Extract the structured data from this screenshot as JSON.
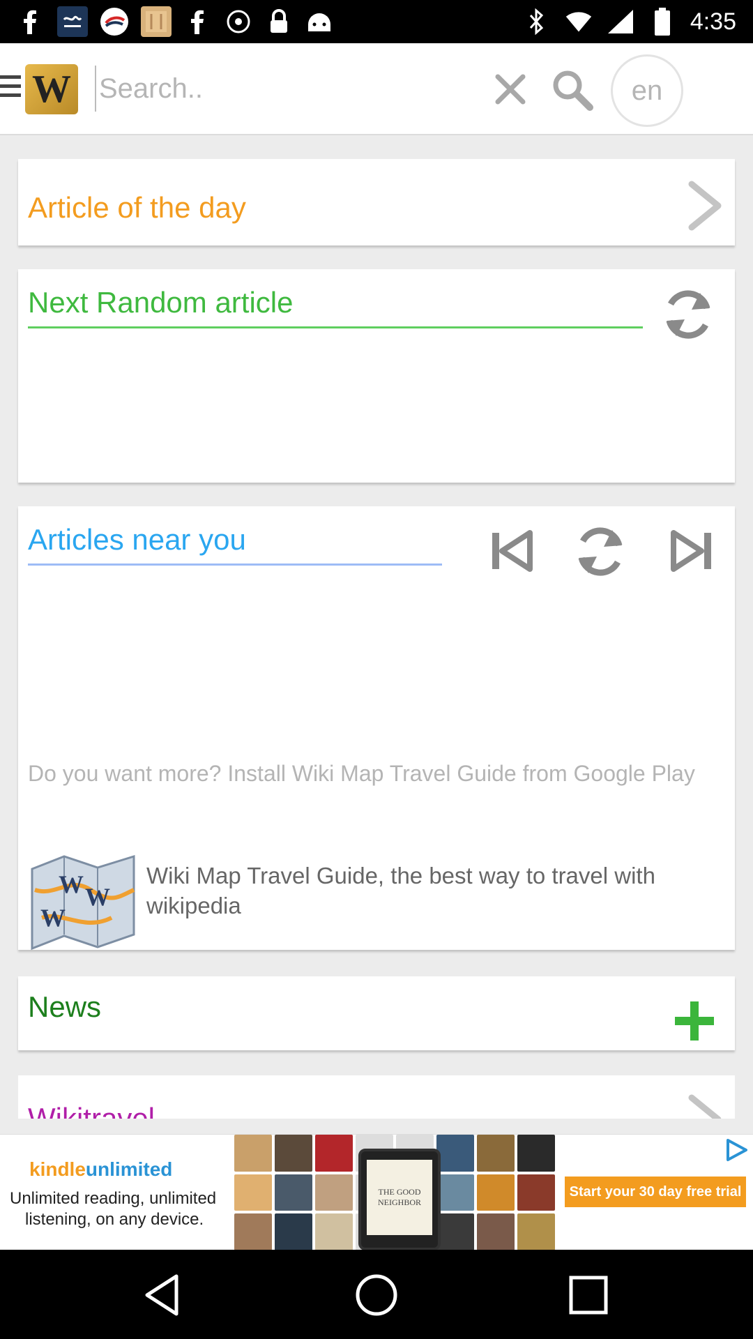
{
  "status_bar": {
    "time": "4:35",
    "notification_icons": [
      "facebook-icon",
      "urdu-app-icon",
      "airline-icon",
      "photo-icon",
      "facebook-icon",
      "messenger-icon",
      "lock-icon",
      "android-icon"
    ],
    "system_icons": [
      "bluetooth-icon",
      "wifi-icon",
      "signal-icon",
      "battery-icon"
    ]
  },
  "header": {
    "logo_text": "W",
    "search_placeholder": "Search..",
    "language": "en"
  },
  "cards": {
    "article_of_day": {
      "title": "Article of the day"
    },
    "random": {
      "title": "Next Random article"
    },
    "near": {
      "title": "Articles near you",
      "promo_text": "Do you want more? Install Wiki Map Travel Guide from Google Play",
      "promo_desc": "Wiki Map Travel Guide, the best way to travel with wikipedia"
    },
    "news": {
      "title": "News"
    },
    "wikitravel": {
      "title": "Wikitravel"
    }
  },
  "ad": {
    "brand_kindle": "kindle",
    "brand_unlimited": "unlimited",
    "line1": "Unlimited reading, unlimited",
    "line2": "listening, on any device.",
    "device_text": "THE GOOD NEIGHBOR",
    "cta": "Start your 30 day free trial"
  },
  "colors": {
    "article_of_day": "#f39c1f",
    "random": "#3fb93f",
    "near": "#2aa6f0",
    "news": "#1d7f1d",
    "wikitravel": "#b01fa8"
  }
}
